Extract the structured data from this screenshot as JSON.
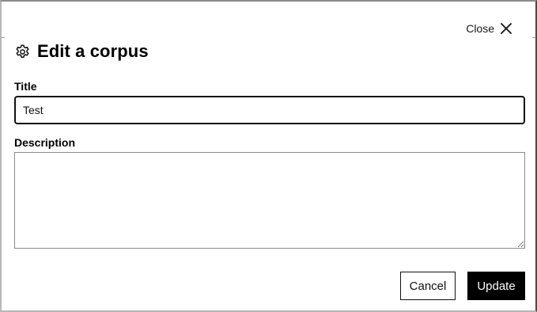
{
  "dialog": {
    "title": "Edit a corpus",
    "close_label": "Close",
    "header_icon": "gear-icon",
    "close_icon": "close-icon"
  },
  "form": {
    "title_label": "Title",
    "title_value": "Test",
    "description_label": "Description",
    "description_value": ""
  },
  "actions": {
    "cancel_label": "Cancel",
    "update_label": "Update"
  },
  "colors": {
    "primary_button_bg": "#000000",
    "primary_button_text": "#ffffff",
    "focused_border": "#111111"
  }
}
